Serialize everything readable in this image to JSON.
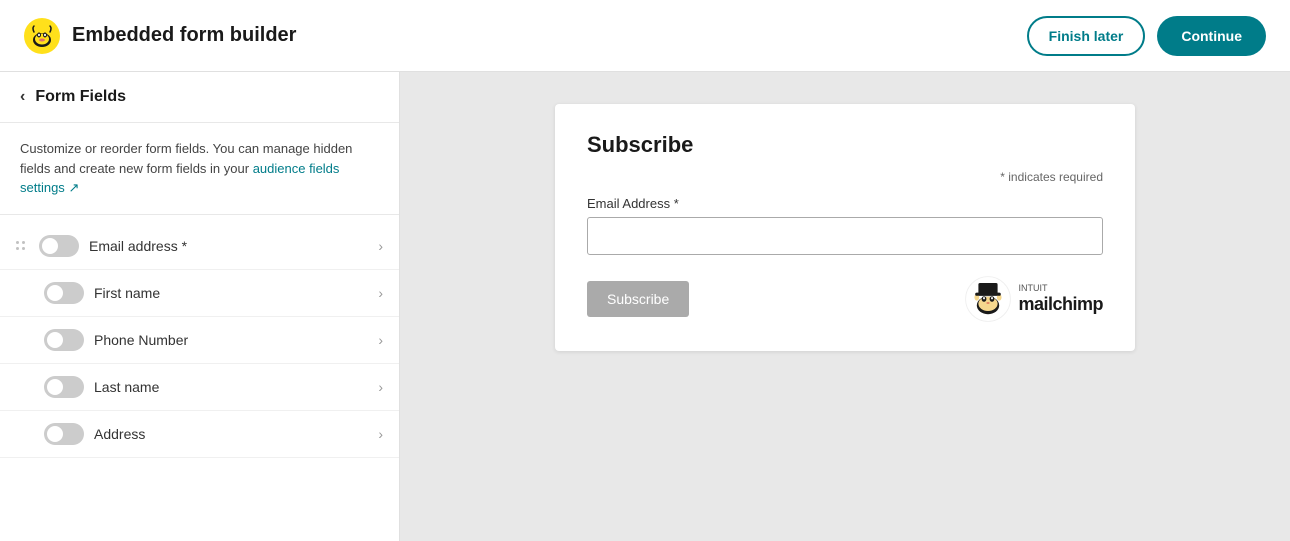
{
  "header": {
    "title": "Embedded form builder",
    "finish_later_label": "Finish later",
    "continue_label": "Continue"
  },
  "sidebar": {
    "back_label": "‹",
    "title": "Form Fields",
    "description": "Customize or reorder form fields. You can manage hidden fields and create new form fields in your",
    "link_text": "audience fields settings",
    "link_icon": "↗",
    "fields": [
      {
        "label": "Email address *",
        "active": false,
        "draggable": true
      },
      {
        "label": "First name",
        "active": false,
        "draggable": false
      },
      {
        "label": "Phone Number",
        "active": false,
        "draggable": false
      },
      {
        "label": "Last name",
        "active": false,
        "draggable": false
      },
      {
        "label": "Address",
        "active": false,
        "draggable": false
      }
    ]
  },
  "preview": {
    "form": {
      "title": "Subscribe",
      "required_note": "* indicates required",
      "email_label": "Email Address *",
      "email_placeholder": "",
      "subscribe_button": "Subscribe"
    },
    "mailchimp": {
      "intuit": "INTUIT",
      "mailchimp": "mailchimp"
    }
  }
}
